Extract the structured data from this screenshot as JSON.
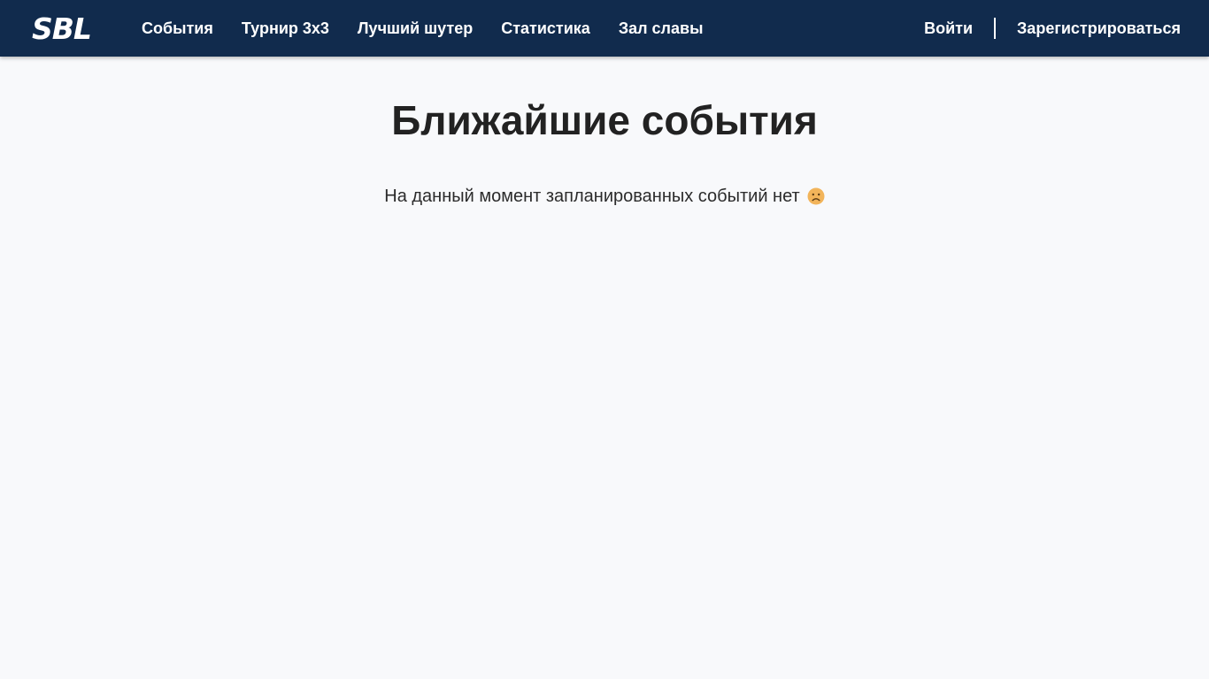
{
  "header": {
    "logo": "SBL",
    "nav": [
      {
        "label": "События"
      },
      {
        "label": "Турнир 3х3"
      },
      {
        "label": "Лучший шутер"
      },
      {
        "label": "Статистика"
      },
      {
        "label": "Зал славы"
      }
    ],
    "login_label": "Войти",
    "register_label": "Зарегистрироваться"
  },
  "main": {
    "title": "Ближайшие события",
    "empty_message": "На данный момент запланированных событий нет",
    "empty_icon": "sad-face-icon"
  },
  "colors": {
    "header_bg": "#112b4d",
    "page_bg": "#f8f9fb",
    "text": "#222222",
    "emoji": "#f2b45a"
  }
}
